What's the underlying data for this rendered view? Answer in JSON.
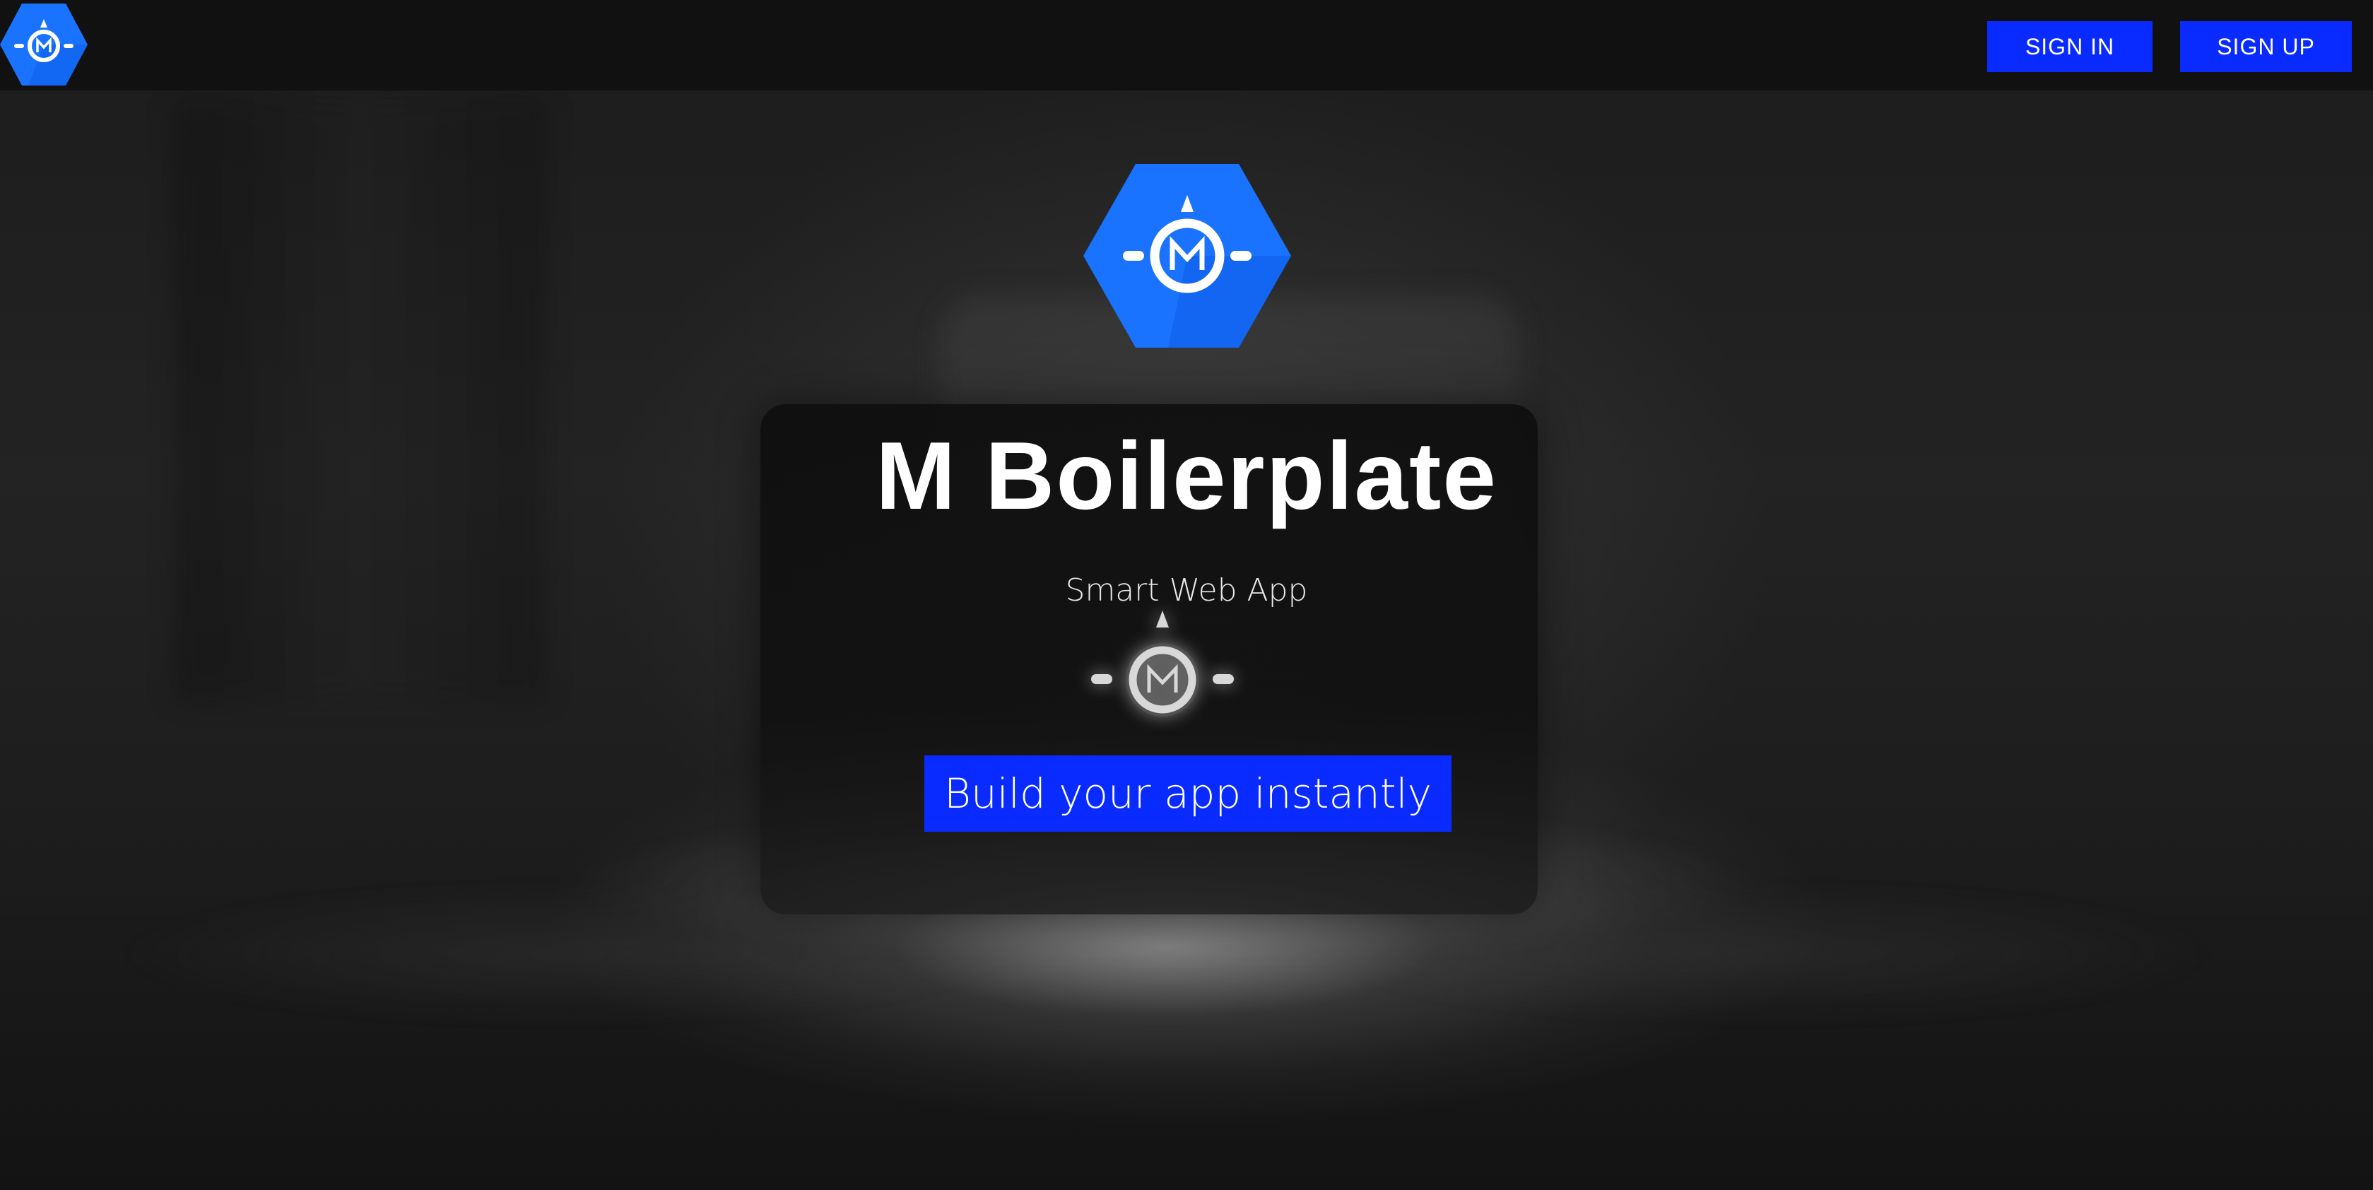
{
  "header": {
    "logo_icon": "m-boilerplate-logo-icon",
    "signin_label": "SIGN IN",
    "signup_label": "SIGN UP"
  },
  "hero": {
    "logo_icon": "m-boilerplate-logo-icon",
    "title": "M Boilerplate",
    "subtitle": "Smart Web App",
    "mark_icon": "m-compass-mark-icon",
    "cta_label": "Build your app instantly"
  },
  "colors": {
    "accent": "#0a2bff",
    "logo_blue": "#1a73ff",
    "logo_blue_dark": "#0d5ee8",
    "background": "#151515"
  }
}
